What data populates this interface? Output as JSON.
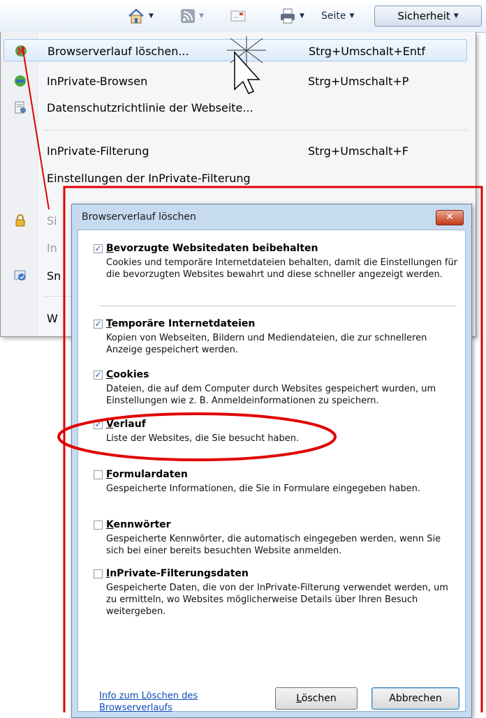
{
  "toolbar": {
    "home_icon": "home-icon",
    "feeds_icon": "rss-icon",
    "mail_icon": "mail-icon",
    "print_icon": "printer-icon",
    "page_label": "Seite",
    "security_label": "Sicherheit",
    "dropdown_glyph": "▼"
  },
  "menu": {
    "items": [
      {
        "label": "Browserverlauf löschen...",
        "shortcut": "Strg+Umschalt+Entf",
        "icon": "delete-history-icon"
      },
      {
        "label": "InPrivate-Browsen",
        "shortcut": "Strg+Umschalt+P",
        "icon": "inprivate-icon"
      },
      {
        "label": "Datenschutzrichtlinie der Webseite...",
        "shortcut": "",
        "icon": "privacy-policy-icon"
      },
      {
        "label": "InPrivate-Filterung",
        "shortcut": "Strg+Umschalt+F",
        "icon": ""
      },
      {
        "label": "Einstellungen der InPrivate-Filterung",
        "shortcut": "",
        "icon": ""
      },
      {
        "label": "Si",
        "shortcut": "",
        "icon": "lock-icon",
        "disabled": true
      },
      {
        "label": "In",
        "shortcut": "",
        "icon": "",
        "disabled": true
      },
      {
        "label": "Sn",
        "shortcut": "",
        "icon": "smartscreen-icon"
      },
      {
        "label": "W",
        "shortcut": "",
        "icon": ""
      }
    ]
  },
  "dialog": {
    "title": "Browserverlauf löschen",
    "close_label": "✕",
    "options": [
      {
        "title_ul": "B",
        "title_rest": "evorzugte Websitedaten beibehalten",
        "checked": true,
        "desc": "Cookies und temporäre Internetdateien behalten, damit die Einstellungen für die bevorzugten Websites bewahrt und diese schneller angezeigt werden."
      },
      {
        "title_ul": "T",
        "title_rest": "emporäre Internetdateien",
        "checked": true,
        "desc": "Kopien von Webseiten, Bildern und Mediendateien, die zur schnelleren Anzeige gespeichert werden."
      },
      {
        "title_ul": "C",
        "title_rest": "ookies",
        "checked": true,
        "desc": "Dateien, die auf dem Computer durch Websites gespeichert wurden, um Einstellungen wie z. B. Anmeldeinformationen zu speichern."
      },
      {
        "title_ul": "V",
        "title_rest": "erlauf",
        "checked": true,
        "desc": "Liste der Websites, die Sie besucht haben."
      },
      {
        "title_ul": "F",
        "title_rest": "ormulardaten",
        "checked": false,
        "desc": "Gespeicherte Informationen, die Sie in Formulare eingegeben haben."
      },
      {
        "title_ul": "K",
        "title_rest": "ennwörter",
        "checked": false,
        "desc": "Gespeicherte Kennwörter, die automatisch eingegeben werden, wenn Sie sich bei einer bereits besuchten Website anmelden."
      },
      {
        "title_ul": "I",
        "title_rest": "nPrivate-Filterungsdaten",
        "checked": false,
        "desc": "Gespeicherte Daten, die von der InPrivate-Filterung verwendet werden, um zu ermitteln, wo Websites möglicherweise Details über Ihren Besuch weitergeben."
      }
    ],
    "help_link": "Info zum Löschen des Browserverlaufs",
    "delete_label_ul": "L",
    "delete_label_rest": "öschen",
    "cancel_label": "Abbrechen"
  },
  "colors": {
    "annotation": "#e00000",
    "dialog_frame": "#c6daf0",
    "close_button": "#c23a17",
    "link": "#0a4bb8"
  }
}
